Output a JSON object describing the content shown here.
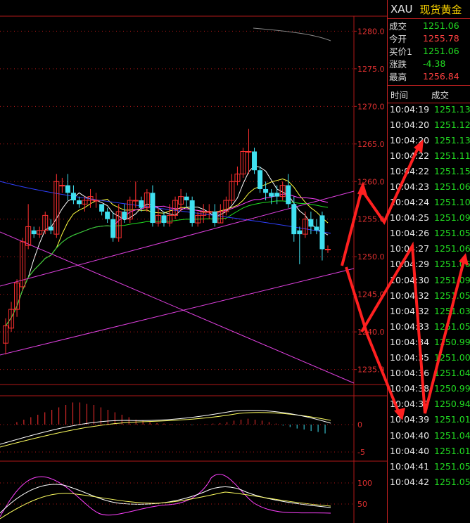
{
  "quote": {
    "symbol": "XAU",
    "name": "现货黄金",
    "rows": [
      {
        "label": "成交",
        "value": "1251.06",
        "color": "green"
      },
      {
        "label": "今开",
        "value": "1255.78",
        "color": "red"
      },
      {
        "label": "买价1",
        "value": "1251.06",
        "color": "green"
      },
      {
        "label": "涨跌",
        "value": "-4.38",
        "color": "green"
      },
      {
        "label": "最高",
        "value": "1256.84",
        "color": "red"
      }
    ]
  },
  "ticks": {
    "col_time": "时间",
    "col_price": "成交",
    "rows": [
      [
        "10:04:19",
        "1251.13"
      ],
      [
        "10:04:20",
        "1251.12"
      ],
      [
        "10:04:20",
        "1251.13"
      ],
      [
        "10:04:22",
        "1251.11"
      ],
      [
        "10:04:22",
        "1251.15"
      ],
      [
        "10:04:23",
        "1251.06"
      ],
      [
        "10:04:24",
        "1251.10"
      ],
      [
        "10:04:25",
        "1251.09"
      ],
      [
        "10:04:26",
        "1251.05"
      ],
      [
        "10:04:27",
        "1251.06"
      ],
      [
        "10:04:29",
        "1251.06"
      ],
      [
        "10:04:30",
        "1251.09"
      ],
      [
        "10:04:32",
        "1251.05"
      ],
      [
        "10:04:32",
        "1251.03"
      ],
      [
        "10:04:33",
        "1251.05"
      ],
      [
        "10:04:34",
        "1250.99"
      ],
      [
        "10:04:35",
        "1251.00"
      ],
      [
        "10:04:36",
        "1251.04"
      ],
      [
        "10:04:38",
        "1250.99"
      ],
      [
        "10:04:39",
        "1250.94"
      ],
      [
        "10:04:39",
        "1251.01"
      ],
      [
        "10:04:40",
        "1251.04"
      ],
      [
        "10:04:40",
        "1251.01"
      ],
      [
        "10:04:41",
        "1251.05"
      ],
      [
        "10:04:42",
        "1251.05"
      ]
    ]
  },
  "colors": {
    "up": "#ff3030",
    "down": "#40e0f0",
    "grid": "#b01818"
  },
  "chart_data": [
    {
      "type": "candlestick",
      "name": "main",
      "y_ticks": [
        "1280.0",
        "1275.0",
        "1270.0",
        "1265.0",
        "1260.0",
        "1255.0",
        "1250.0",
        "1245.0",
        "1240.0",
        "1235.0"
      ],
      "ylim": [
        1233,
        1282
      ],
      "candles": [
        [
          1238.5,
          1240.8,
          1237.0,
          1241.8
        ],
        [
          1240.5,
          1243.0,
          1240.0,
          1244.0
        ],
        [
          1243.0,
          1246.5,
          1242.0,
          1247.0
        ],
        [
          1246.0,
          1252.0,
          1245.5,
          1252.5
        ],
        [
          1251.5,
          1254.0,
          1251.0,
          1257.0
        ],
        [
          1253.5,
          1253.0,
          1252.5,
          1254.0
        ],
        [
          1253.0,
          1253.5,
          1252.5,
          1254.0
        ],
        [
          1253.5,
          1255.5,
          1253.0,
          1256.0
        ],
        [
          1254.0,
          1253.5,
          1253.0,
          1255.0
        ],
        [
          1253.0,
          1260.0,
          1252.5,
          1261.0
        ],
        [
          1259.5,
          1259.5,
          1258.5,
          1260.5
        ],
        [
          1259.5,
          1258.5,
          1257.5,
          1261.0
        ],
        [
          1258.5,
          1257.5,
          1257.0,
          1259.5
        ],
        [
          1257.5,
          1257.0,
          1256.5,
          1258.0
        ],
        [
          1257.0,
          1257.5,
          1256.0,
          1258.0
        ],
        [
          1257.5,
          1258.0,
          1256.5,
          1259.0
        ],
        [
          1257.5,
          1257.5,
          1256.5,
          1258.5
        ],
        [
          1257.0,
          1256.0,
          1255.5,
          1257.0
        ],
        [
          1256.0,
          1255.0,
          1254.5,
          1256.5
        ],
        [
          1255.0,
          1252.5,
          1252.0,
          1256.0
        ],
        [
          1252.5,
          1256.0,
          1252.0,
          1257.0
        ],
        [
          1256.0,
          1255.0,
          1254.5,
          1257.0
        ],
        [
          1255.0,
          1257.5,
          1254.5,
          1258.0
        ],
        [
          1257.5,
          1257.5,
          1256.5,
          1260.0
        ],
        [
          1257.5,
          1256.5,
          1256.0,
          1258.0
        ],
        [
          1256.5,
          1258.5,
          1256.0,
          1259.0
        ],
        [
          1258.5,
          1254.5,
          1254.0,
          1259.5
        ],
        [
          1254.5,
          1255.5,
          1254.0,
          1256.5
        ],
        [
          1255.5,
          1254.5,
          1254.0,
          1256.0
        ],
        [
          1254.5,
          1255.5,
          1254.0,
          1257.0
        ],
        [
          1255.5,
          1257.5,
          1255.0,
          1258.0
        ],
        [
          1257.0,
          1258.0,
          1256.0,
          1259.0
        ],
        [
          1258.0,
          1257.5,
          1256.5,
          1258.5
        ],
        [
          1257.5,
          1254.5,
          1254.0,
          1258.0
        ],
        [
          1254.5,
          1255.5,
          1254.0,
          1256.0
        ],
        [
          1255.5,
          1256.0,
          1254.5,
          1257.0
        ],
        [
          1256.0,
          1256.0,
          1255.0,
          1257.0
        ],
        [
          1256.0,
          1254.5,
          1254.0,
          1257.0
        ],
        [
          1254.5,
          1256.0,
          1254.5,
          1257.0
        ],
        [
          1256.0,
          1257.5,
          1255.5,
          1258.0
        ],
        [
          1257.5,
          1260.0,
          1257.0,
          1261.0
        ],
        [
          1260.0,
          1261.0,
          1259.5,
          1262.0
        ],
        [
          1261.0,
          1264.0,
          1260.5,
          1264.5
        ],
        [
          1264.0,
          1264.0,
          1261.0,
          1267.0
        ],
        [
          1264.0,
          1261.5,
          1261.0,
          1264.5
        ],
        [
          1261.5,
          1259.0,
          1258.5,
          1262.0
        ],
        [
          1259.0,
          1258.5,
          1257.5,
          1260.0
        ],
        [
          1258.5,
          1258.0,
          1257.0,
          1259.0
        ],
        [
          1258.5,
          1258.0,
          1257.0,
          1259.5
        ],
        [
          1258.0,
          1259.5,
          1257.5,
          1260.0
        ],
        [
          1259.5,
          1257.0,
          1256.5,
          1261.0
        ],
        [
          1257.0,
          1253.0,
          1252.0,
          1258.0
        ],
        [
          1253.5,
          1253.0,
          1249.0,
          1254.0
        ],
        [
          1253.0,
          1255.0,
          1252.5,
          1256.0
        ],
        [
          1255.0,
          1254.0,
          1253.0,
          1256.0
        ],
        [
          1254.0,
          1253.5,
          1253.0,
          1255.0
        ],
        [
          1255.5,
          1251.0,
          1249.5,
          1256.0
        ],
        [
          1251.0,
          1251.0,
          1250.5,
          1251.5
        ]
      ]
    },
    {
      "type": "bar",
      "name": "macd",
      "y_ticks": [
        "0",
        "-5"
      ],
      "values": [
        0,
        0,
        0.5,
        1,
        1.5,
        2,
        2.5,
        3,
        3.5,
        4,
        4.5,
        4.5,
        4.2,
        4,
        3.5,
        3,
        2.5,
        2,
        1.5,
        1,
        0.8,
        0.5,
        0.3,
        0.2,
        0.1,
        0.05,
        0,
        -0.1,
        0,
        0.1,
        0.2,
        0.3,
        0.5,
        0.8,
        1,
        1.2,
        1,
        0.8,
        0.5,
        0.2,
        -0.2,
        -0.5,
        -0.8,
        -1,
        -1.3,
        -1.5,
        -1.8
      ]
    },
    {
      "type": "line",
      "name": "kdj",
      "y_ticks": [
        "100",
        "50"
      ]
    }
  ]
}
